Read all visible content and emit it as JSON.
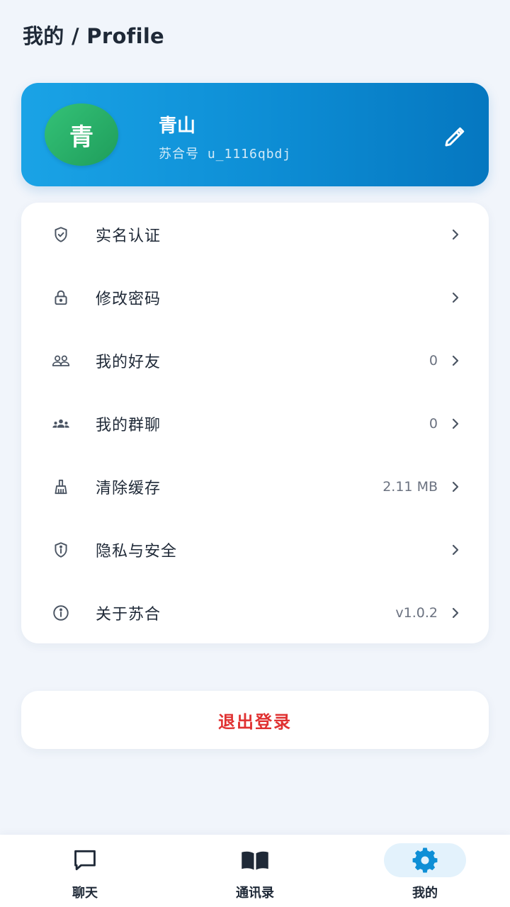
{
  "header": {
    "title": "我的 / Profile"
  },
  "profile": {
    "avatar_text": "青",
    "name": "青山",
    "id_text": "苏合号  u_1116qbdj"
  },
  "menu": {
    "items": [
      {
        "label": "实名认证",
        "value": "",
        "icon": "shield-check-icon"
      },
      {
        "label": "修改密码",
        "value": "",
        "icon": "lock-icon"
      },
      {
        "label": "我的好友",
        "value": "0",
        "icon": "friends-icon"
      },
      {
        "label": "我的群聊",
        "value": "0",
        "icon": "group-icon"
      },
      {
        "label": "清除缓存",
        "value": "2.11 MB",
        "icon": "broom-icon"
      },
      {
        "label": "隐私与安全",
        "value": "",
        "icon": "shield-info-icon"
      },
      {
        "label": "关于苏合",
        "value": "v1.0.2",
        "icon": "info-icon"
      }
    ]
  },
  "logout": {
    "label": "退出登录"
  },
  "bottom_nav": {
    "items": [
      {
        "label": "聊天",
        "icon": "chat-icon",
        "active": false
      },
      {
        "label": "通讯录",
        "icon": "book-icon",
        "active": false
      },
      {
        "label": "我的",
        "icon": "gear-icon",
        "active": true
      }
    ]
  },
  "colors": {
    "accent": "#0e8fd6",
    "avatar": "#2bb06a",
    "logout": "#e03131",
    "active_nav_bg": "#e3f2fc",
    "active_nav_icon": "#0e8fd6"
  }
}
